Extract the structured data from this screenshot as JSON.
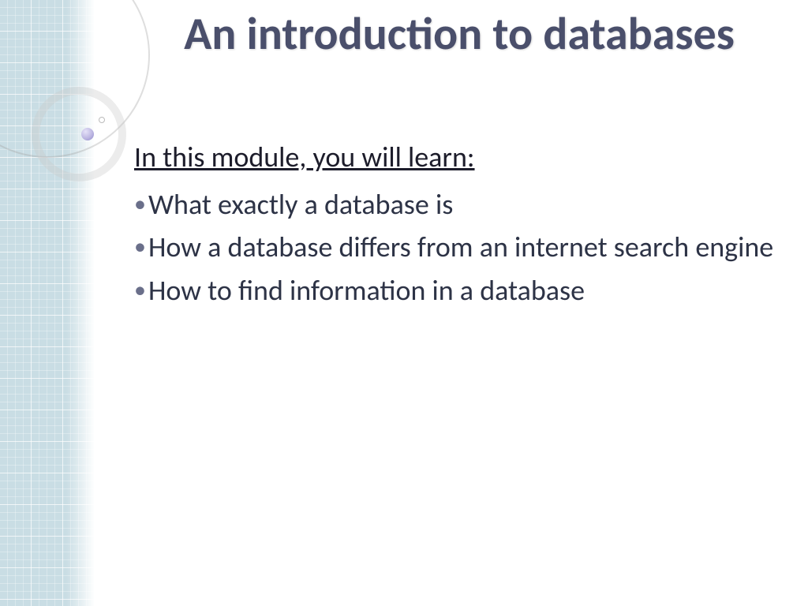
{
  "slide": {
    "title": "An introduction to databases",
    "subheading": "In this module, you will learn:",
    "bullets": [
      "What exactly a database is",
      "How a database differs from an internet search engine",
      "How to find information in a database"
    ]
  }
}
